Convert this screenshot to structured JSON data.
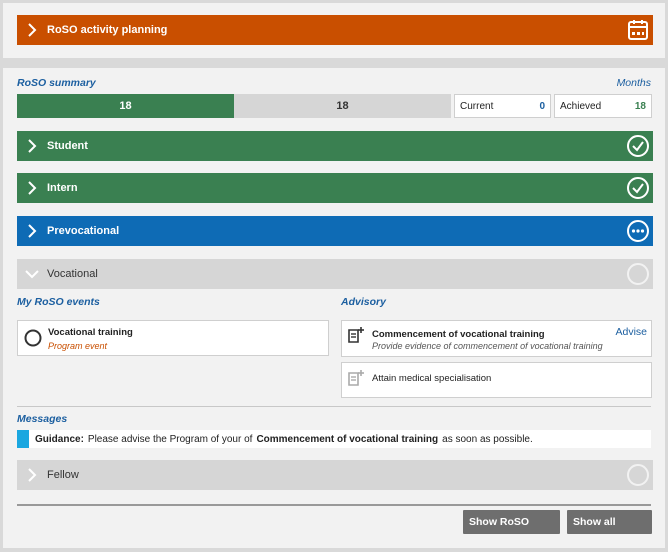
{
  "activity_banner": {
    "label": "RoSO activity planning",
    "icon": "calendar-icon"
  },
  "summary": {
    "title": "RoSO summary",
    "months_label": "Months",
    "progress": {
      "achieved_value": "18",
      "remaining_value": "18",
      "achieved_fraction": 0.5
    },
    "current": {
      "label": "Current",
      "value": "0"
    },
    "achieved": {
      "label": "Achieved",
      "value": "18"
    }
  },
  "stages": [
    {
      "label": "Student",
      "status": "complete"
    },
    {
      "label": "Intern",
      "status": "complete"
    },
    {
      "label": "Prevocational",
      "status": "in-progress"
    },
    {
      "label": "Vocational",
      "status": "expanded"
    }
  ],
  "my_events": {
    "title": "My RoSO events",
    "items": [
      {
        "title": "Vocational training",
        "subtitle": "Program event"
      }
    ]
  },
  "advisory": {
    "title": "Advisory",
    "items": [
      {
        "title": "Commencement of vocational training",
        "subtitle": "Provide evidence of commencement of vocational training",
        "action": "Advise"
      },
      {
        "title": "Attain medical specialisation"
      }
    ]
  },
  "messages": {
    "title": "Messages",
    "guidance_label": "Guidance:",
    "text_before": "Please advise the Program of your of",
    "emphasis": "Commencement of vocational training",
    "text_after": "as soon as possible."
  },
  "fellow": {
    "label": "Fellow"
  },
  "buttons": {
    "show_roso": "Show RoSO",
    "show_all": "Show all"
  },
  "colors": {
    "orange": "#c94f00",
    "green": "#3a8051",
    "blue": "#0e6bb5",
    "link": "#1c5fa0",
    "accent": "#1aa7e0"
  }
}
